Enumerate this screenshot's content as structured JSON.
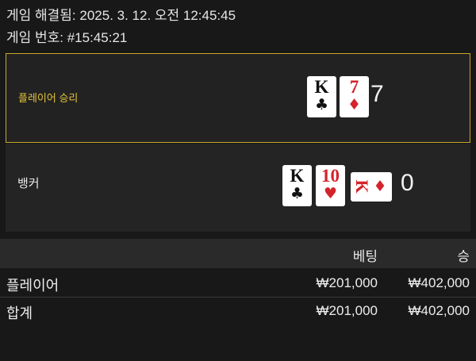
{
  "meta": {
    "resolved": "게임 해결됨: 2025. 3. 12. 오전 12:45:45",
    "game_number": "게임 번호: #15:45:21"
  },
  "player": {
    "label": "플레이어 승리",
    "score": "7",
    "cards": [
      {
        "rank": "K",
        "suit": "♣",
        "color": "#111111"
      },
      {
        "rank": "7",
        "suit": "♦",
        "color": "#d4232a"
      }
    ]
  },
  "banker": {
    "label": "뱅커",
    "score": "0",
    "cards": [
      {
        "rank": "K",
        "suit": "♣",
        "color": "#111111"
      },
      {
        "rank": "10",
        "suit": "♥",
        "color": "#d4232a"
      },
      {
        "rank": "K",
        "suit": "♦",
        "color": "#d4232a",
        "rotated": true
      }
    ]
  },
  "table": {
    "headers": {
      "bet": "베팅",
      "win": "승"
    },
    "rows": [
      {
        "label": "플레이어",
        "bet": "₩201,000",
        "win": "₩402,000"
      }
    ],
    "total": {
      "label": "합계",
      "bet": "₩201,000",
      "win": "₩402,000"
    }
  },
  "colors": {
    "winner_accent": "#c9a72a",
    "winner_text": "#e2c23a",
    "background": "#181818",
    "panel": "#242424"
  }
}
